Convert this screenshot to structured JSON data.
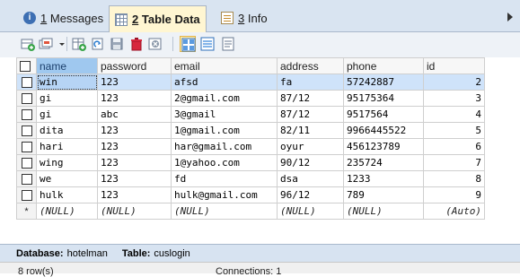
{
  "tabs": [
    {
      "num": "1",
      "label": "Messages",
      "icon": "info-icon",
      "active": false
    },
    {
      "num": "2",
      "label": "Table Data",
      "icon": "table-grid-icon",
      "active": true
    },
    {
      "num": "3",
      "label": "Info",
      "icon": "document-icon",
      "active": false
    }
  ],
  "toolbar": {
    "buttons": [
      "add-row",
      "duplicate-row",
      "insert-row",
      "refresh",
      "save",
      "delete",
      "cancel",
      "grid-view",
      "form-view",
      "text-view"
    ],
    "selected": "grid-view"
  },
  "table": {
    "columns": [
      "name",
      "password",
      "email",
      "address",
      "phone",
      "id"
    ],
    "rows": [
      [
        "win",
        "123",
        "afsd",
        "fa",
        "57242887",
        "2"
      ],
      [
        "gi",
        "123",
        "2@gmail.com",
        "87/12",
        "95175364",
        "3"
      ],
      [
        "gi",
        "abc",
        "3@gmail",
        "87/12",
        "9517564",
        "4"
      ],
      [
        "dita",
        "123",
        "1@gmail.com",
        "82/11",
        "9966445522",
        "5"
      ],
      [
        "hari",
        "123",
        "har@gmail.com",
        "oyur",
        "456123789",
        "6"
      ],
      [
        "wing",
        "123",
        "1@yahoo.com",
        "90/12",
        "235724",
        "7"
      ],
      [
        "we",
        "123",
        "fd",
        "dsa",
        "1233",
        "8"
      ],
      [
        "hulk",
        "123",
        "hulk@gmail.com",
        "96/12",
        "789",
        "9"
      ]
    ],
    "new_row": {
      "marker": "*",
      "cells": [
        "(NULL)",
        "(NULL)",
        "(NULL)",
        "(NULL)",
        "(NULL)",
        "(Auto)"
      ]
    },
    "current_row": 0
  },
  "status": {
    "database_label": "Database:",
    "database": "hotelman",
    "table_label": "Table:",
    "table": "cuslogin"
  },
  "bottom": {
    "rows": "8 row(s)",
    "connections": "Connections: 1"
  },
  "colors": {
    "tab_active_bg": "#fff6d2",
    "tabstrip_bg": "#d9e4f1",
    "selected_header": "#9fc8ef",
    "current_row": "#cfe3fa",
    "statusbar_bg": "#d7e3f1"
  }
}
